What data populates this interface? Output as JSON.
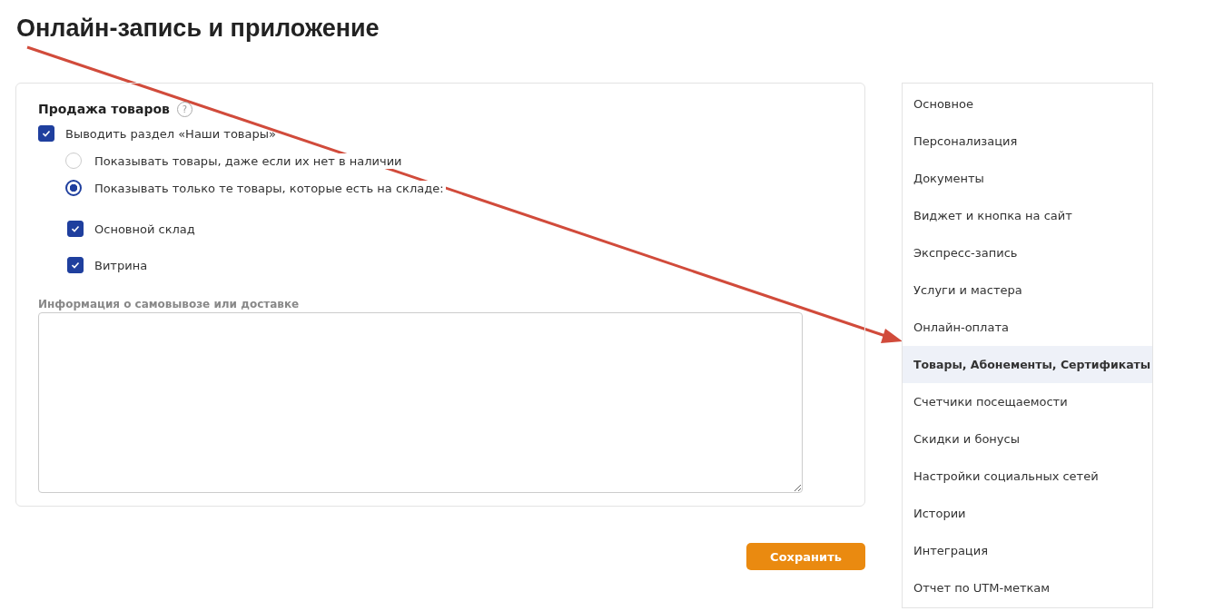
{
  "page": {
    "title": "Онлайн-запись и приложение"
  },
  "section": {
    "title": "Продажа товаров",
    "help_icon": "?",
    "main_option": {
      "label": "Выводить раздел «Наши товары»",
      "checked": true
    },
    "radios": [
      {
        "label": "Показывать товары, даже если их нет в наличии",
        "selected": false
      },
      {
        "label": "Показывать только те товары, которые есть на складе:",
        "selected": true
      }
    ],
    "warehouses": [
      {
        "label": "Основной склад",
        "checked": true
      },
      {
        "label": "Витрина",
        "checked": true
      }
    ],
    "delivery_info": {
      "label": "Информация о самовывозе или доставке"
    }
  },
  "save_button": "Сохранить",
  "sidebar": {
    "items": [
      {
        "label": "Основное",
        "selected": false
      },
      {
        "label": "Персонализация",
        "selected": false
      },
      {
        "label": "Документы",
        "selected": false
      },
      {
        "label": "Виджет и кнопка на сайт",
        "selected": false
      },
      {
        "label": "Экспресс-запись",
        "selected": false
      },
      {
        "label": "Услуги и мастера",
        "selected": false
      },
      {
        "label": "Онлайн-оплата",
        "selected": false
      },
      {
        "label": "Товары, Абонементы, Сертификаты",
        "selected": true
      },
      {
        "label": "Счетчики посещаемости",
        "selected": false
      },
      {
        "label": "Скидки и бонусы",
        "selected": false
      },
      {
        "label": "Настройки социальных сетей",
        "selected": false
      },
      {
        "label": "Истории",
        "selected": false
      },
      {
        "label": "Интеграция",
        "selected": false
      },
      {
        "label": "Отчет по UTM-меткам",
        "selected": false
      }
    ]
  }
}
